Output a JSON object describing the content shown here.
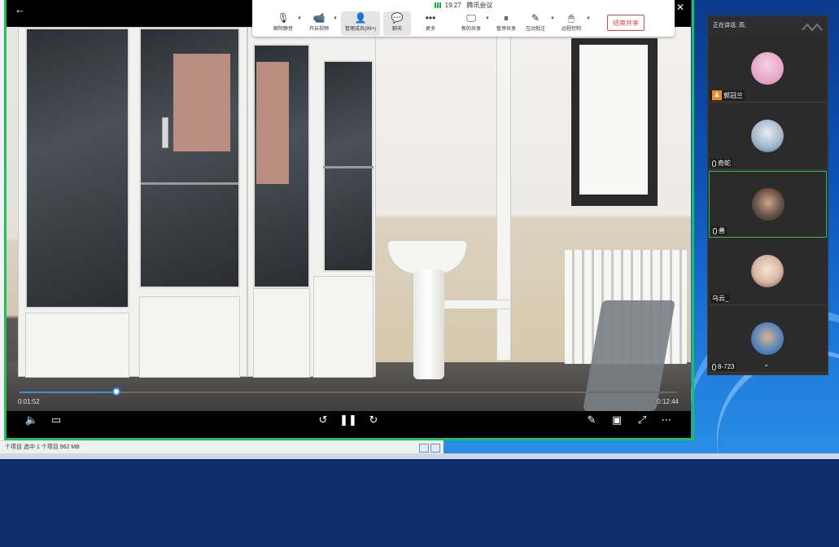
{
  "meeting": {
    "time": "19:27",
    "app_name": "腾讯会议",
    "tools": [
      {
        "label": "解除静音",
        "icon": "mic-muted-icon"
      },
      {
        "label": "开启视频",
        "icon": "camera-off-icon"
      },
      {
        "label": "管理成员(99+)",
        "icon": "members-icon"
      },
      {
        "label": "聊天",
        "icon": "chat-icon"
      },
      {
        "label": "更多",
        "icon": "more-icon"
      },
      {
        "label": "新的共享",
        "icon": "share-screen-icon"
      },
      {
        "label": "暂停共享",
        "icon": "pause-share-icon"
      },
      {
        "label": "互动批注",
        "icon": "annotate-icon"
      },
      {
        "label": "远程控制",
        "icon": "remote-control-icon"
      }
    ],
    "end_share_label": "结束共享"
  },
  "player": {
    "current_time": "0:01:52",
    "total_time": "0:12:44",
    "progress": 0.147
  },
  "panel": {
    "speaking_label": "正在讲话: 高;",
    "participants": [
      {
        "name": "郭冠兰",
        "host": true
      },
      {
        "name": "奇蛇",
        "host": false
      },
      {
        "name": "善",
        "host": false,
        "speaking": true
      },
      {
        "name": "乌云_",
        "host": false
      },
      {
        "name": "8-723",
        "host": false
      }
    ]
  },
  "explorer": {
    "status_items": "个项目  选中 1 个项目  962 MB"
  }
}
